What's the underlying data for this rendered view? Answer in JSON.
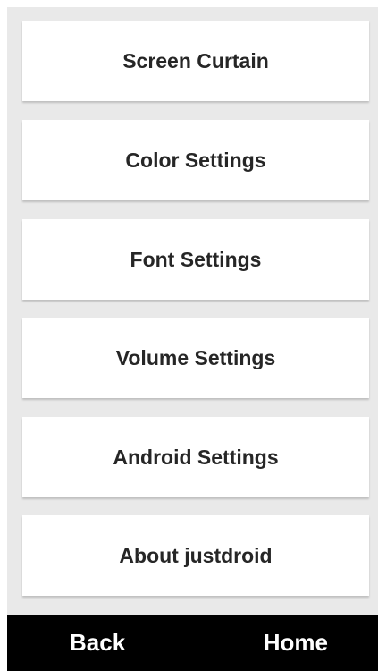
{
  "menu": {
    "items": [
      {
        "label": "Screen Curtain"
      },
      {
        "label": "Color Settings"
      },
      {
        "label": "Font Settings"
      },
      {
        "label": "Volume Settings"
      },
      {
        "label": "Android Settings"
      },
      {
        "label": "About justdroid"
      }
    ]
  },
  "nav": {
    "back_label": "Back",
    "home_label": "Home"
  },
  "colors": {
    "background": "#e9e9e9",
    "card": "#ffffff",
    "card_text": "#262626",
    "nav_bar": "#000000",
    "nav_text": "#ffffff"
  }
}
